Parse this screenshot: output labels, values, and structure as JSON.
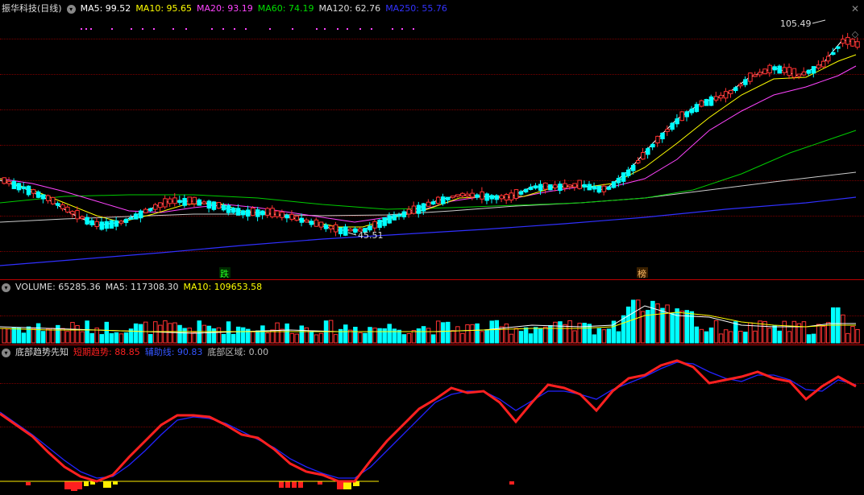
{
  "main": {
    "title": "振华科技(日线)",
    "ma": [
      {
        "label": "MA5: 99.52",
        "color": "#ffffff"
      },
      {
        "label": "MA10: 95.65",
        "color": "#ffff00"
      },
      {
        "label": "MA20: 93.19",
        "color": "#ff44ff"
      },
      {
        "label": "MA60: 74.19",
        "color": "#00dd00"
      },
      {
        "label": "MA120: 62.76",
        "color": "#dddddd"
      },
      {
        "label": "MA250: 55.76",
        "color": "#3333ff"
      }
    ],
    "high_label": "105.49",
    "low_label": "45.51",
    "marker_die": "跌",
    "marker_bang": "榜"
  },
  "volume": {
    "label": "VOLUME: 65285.36",
    "ma5": "MA5: 117308.30",
    "ma10": "MA10: 109653.58"
  },
  "indicator": {
    "name": "底部趋势先知",
    "short": "短期趋势: 88.85",
    "aux": "辅助线: 90.83",
    "bottom": "底部区域: 0.00"
  },
  "colors": {
    "up": "#ff3232",
    "down": "#00ffff",
    "short_line": "#ff2020",
    "aux_line": "#2222ff"
  }
}
